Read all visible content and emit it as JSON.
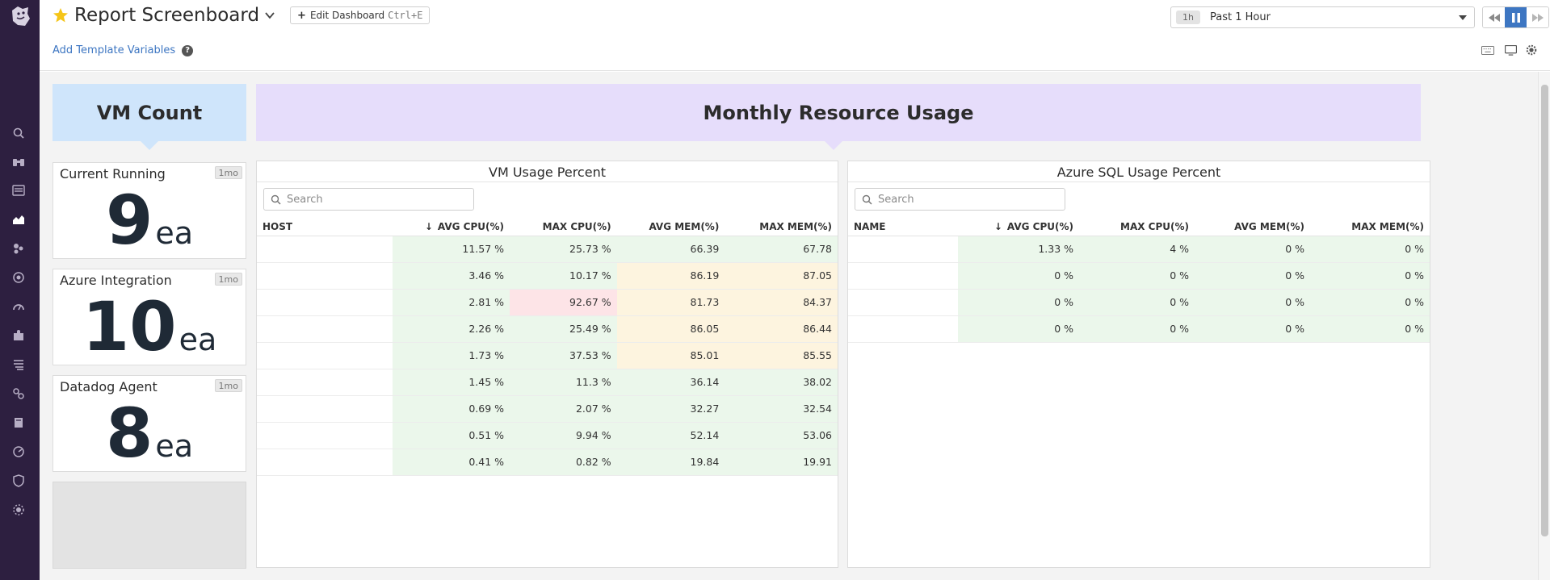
{
  "header": {
    "title": "Report Screenboard",
    "edit_label": "Edit Dashboard",
    "edit_shortcut": "Ctrl+E",
    "add_template_label": "Add Template Variables",
    "time_badge": "1h",
    "time_label": "Past 1 Hour"
  },
  "notes": {
    "vm_count": "VM Count",
    "monthly": "Monthly Resource Usage"
  },
  "query_values": [
    {
      "title": "Current Running",
      "badge": "1mo",
      "value": "9",
      "unit": "ea"
    },
    {
      "title": "Azure Integration",
      "badge": "1mo",
      "value": "10",
      "unit": "ea"
    },
    {
      "title": "Datadog Agent",
      "badge": "1mo",
      "value": "8",
      "unit": "ea"
    }
  ],
  "vm_table": {
    "title": "VM Usage Percent",
    "search_placeholder": "Search",
    "columns": [
      "HOST",
      "AVG CPU(%)",
      "MAX CPU(%)",
      "AVG MEM(%)",
      "MAX MEM(%)"
    ],
    "rows": [
      [
        "",
        "11.57 %",
        "25.73 %",
        "66.39",
        "67.78"
      ],
      [
        "",
        "3.46 %",
        "10.17 %",
        "86.19",
        "87.05"
      ],
      [
        "",
        "2.81 %",
        "92.67 %",
        "81.73",
        "84.37"
      ],
      [
        "",
        "2.26 %",
        "25.49 %",
        "86.05",
        "86.44"
      ],
      [
        "",
        "1.73 %",
        "37.53 %",
        "85.01",
        "85.55"
      ],
      [
        "",
        "1.45 %",
        "11.3 %",
        "36.14",
        "38.02"
      ],
      [
        "",
        "0.69 %",
        "2.07 %",
        "32.27",
        "32.54"
      ],
      [
        "",
        "0.51 %",
        "9.94 %",
        "52.14",
        "53.06"
      ],
      [
        "",
        "0.41 %",
        "0.82 %",
        "19.84",
        "19.91"
      ]
    ],
    "row_colors": [
      [
        "",
        "g",
        "g",
        "g",
        "g"
      ],
      [
        "",
        "g",
        "g",
        "y",
        "y"
      ],
      [
        "",
        "g",
        "r",
        "y",
        "y"
      ],
      [
        "",
        "g",
        "g",
        "y",
        "y"
      ],
      [
        "",
        "g",
        "g",
        "y",
        "y"
      ],
      [
        "",
        "g",
        "g",
        "g",
        "g"
      ],
      [
        "",
        "g",
        "g",
        "g",
        "g"
      ],
      [
        "",
        "g",
        "g",
        "g",
        "g"
      ],
      [
        "",
        "g",
        "g",
        "g",
        "g"
      ]
    ]
  },
  "sql_table": {
    "title": "Azure SQL Usage Percent",
    "search_placeholder": "Search",
    "columns": [
      "NAME",
      "AVG CPU(%)",
      "MAX CPU(%)",
      "AVG MEM(%)",
      "MAX MEM(%)"
    ],
    "rows": [
      [
        "",
        "1.33 %",
        "4 %",
        "0 %",
        "0 %"
      ],
      [
        "",
        "0 %",
        "0 %",
        "0 %",
        "0 %"
      ],
      [
        "",
        "0 %",
        "0 %",
        "0 %",
        "0 %"
      ],
      [
        "",
        "0 %",
        "0 %",
        "0 %",
        "0 %"
      ]
    ],
    "row_colors": [
      [
        "",
        "g",
        "g",
        "g",
        "g"
      ],
      [
        "",
        "g",
        "g",
        "g",
        "g"
      ],
      [
        "",
        "g",
        "g",
        "g",
        "g"
      ],
      [
        "",
        "g",
        "g",
        "g",
        "g"
      ]
    ]
  },
  "colors": {
    "nav_bg": "#2d1f40",
    "accent": "#3d76c2",
    "star": "#f5c518",
    "cell_green": "#ebf7eb",
    "cell_yellow": "#fdf4df",
    "cell_red": "#fde4e7"
  }
}
